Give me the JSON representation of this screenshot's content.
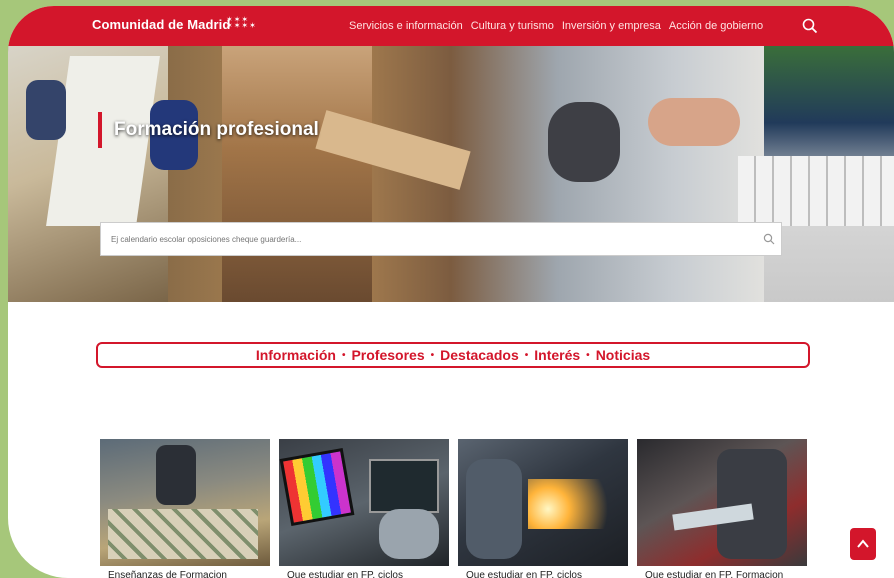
{
  "header": {
    "brand": "Comunidad de Madrid",
    "nav": [
      "Servicios e información",
      "Cultura y turismo",
      "Inversión y empresa",
      "Acción de gobierno"
    ]
  },
  "hero": {
    "title": "Formación profesional",
    "search_placeholder": "Ej calendario escolar oposiciones cheque guardería..."
  },
  "tabs": {
    "items": [
      "Información",
      "Profesores",
      "Destacados",
      "Interés",
      "Noticias"
    ],
    "separator": "•"
  },
  "cards": [
    {
      "caption": "Enseñanzas de Formacion"
    },
    {
      "caption": "Que estudiar en FP. ciclos"
    },
    {
      "caption": "Que estudiar en FP. ciclos"
    },
    {
      "caption": "Que estudiar en FP. Formacion"
    }
  ],
  "colors": {
    "accent": "#d3162b",
    "frame_bg": "#a6c77a"
  },
  "icons": {
    "top_search": "search-icon",
    "hero_search": "search-icon",
    "scroll_top": "chevron-up-icon"
  }
}
